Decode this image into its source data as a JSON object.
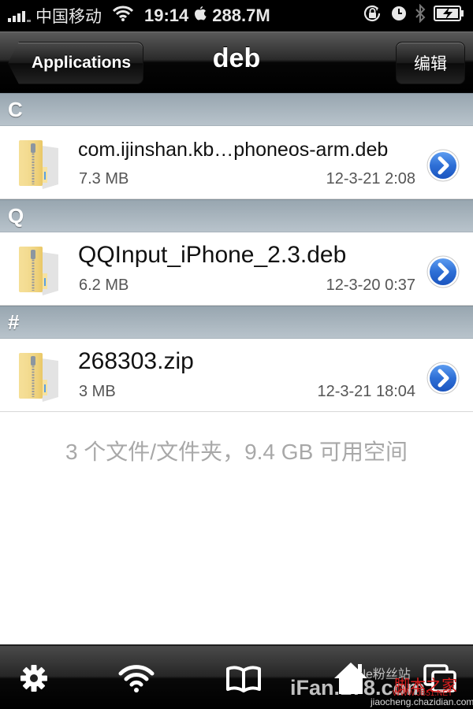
{
  "status_bar": {
    "carrier": "中国移动",
    "time": "19:14",
    "memory": "288.7M",
    "icons": [
      "signal-icon",
      "wifi-icon",
      "apple-icon",
      "rotation-lock-icon",
      "alarm-clock-icon",
      "bluetooth-icon",
      "battery-charging-icon"
    ]
  },
  "nav_bar": {
    "back_label": "Applications",
    "title": "deb",
    "edit_label": "编辑"
  },
  "sections": [
    {
      "header": "C",
      "items": [
        {
          "name": "com.ijinshan.kb…phoneos-arm.deb",
          "size": "7.3 MB",
          "date": "12-3-21 2:08",
          "icon": "zip-folder-icon"
        }
      ]
    },
    {
      "header": "Q",
      "items": [
        {
          "name": "QQInput_iPhone_2.3.deb",
          "size": "6.2 MB",
          "date": "12-3-20 0:37",
          "icon": "zip-folder-icon"
        }
      ]
    },
    {
      "header": "#",
      "items": [
        {
          "name": "268303.zip",
          "size": "3 MB",
          "date": "12-3-21 18:04",
          "icon": "zip-folder-icon"
        }
      ]
    }
  ],
  "footer_info": "3 个文件/文件夹，9.4 GB 可用空间",
  "tab_bar": {
    "tabs": [
      {
        "icon": "gear-icon"
      },
      {
        "icon": "wifi-icon"
      },
      {
        "icon": "book-icon"
      },
      {
        "icon": "home-icon"
      },
      {
        "icon": "windows-icon"
      }
    ]
  },
  "watermarks": {
    "ifan": "iFan.178.com",
    "apple_fans": "Apple粉丝站",
    "jb51": "脚本之家",
    "jb51_url": "WWW.JB51.NET",
    "chazidian": "jiaocheng.chazidian.com"
  },
  "colors": {
    "disclosure_blue": "#2f6fd6",
    "section_header": "#a9b5be",
    "footer_text": "#a8a8a8"
  }
}
